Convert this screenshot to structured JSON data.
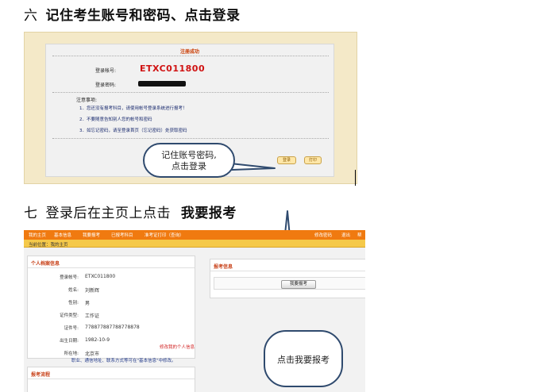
{
  "step6": {
    "number": "六",
    "title": "记住考生账号和密码、点击登录"
  },
  "screenshot1": {
    "success_title": "注册成功",
    "account_label": "登录帐号:",
    "account_value": "ETXC011800",
    "password_label": "登录密码:",
    "notes_title": "注意事项:",
    "notes": [
      "1．您还没有报考科目，请使用帐号登录系统进行报考！",
      "2．不要随意告知别人您的帐号和密码",
      "3．如忘记密码，请至登录首页（忘记密码）处获取密码"
    ],
    "login_button": "登录",
    "print_button": "打印",
    "callout": [
      "记住账号密码,",
      "点击登录"
    ]
  },
  "step7": {
    "number": "七",
    "title_plain": "登录后在主页上点击",
    "title_bold": "我要报考"
  },
  "screenshot2": {
    "nav": [
      "我的主页",
      "基本信息",
      "我要报考",
      "已报考科目",
      "准考证打印（查询）"
    ],
    "nav_right": [
      "修改密码",
      "退出",
      "帮"
    ],
    "location_label": "当前位置：我的主页",
    "profile_title": "个人档案信息",
    "profile_fields": [
      {
        "label": "登录帐号:",
        "value": "ETXC011800"
      },
      {
        "label": "姓名:",
        "value": "刘新辉"
      },
      {
        "label": "性别:",
        "value": "男"
      },
      {
        "label": "证件类型:",
        "value": "工作证"
      },
      {
        "label": "证件号:",
        "value": "778877887788778878"
      },
      {
        "label": "出生日期:",
        "value": "1982-10-9"
      },
      {
        "label": "所在地:",
        "value": "北京市"
      }
    ],
    "edit_link": "修改我的个人信息",
    "edit_note": "职业、通信地址、联系方式等可在\"基本信息\"中修改。",
    "flow_title": "报考流程",
    "exam_title": "报考信息",
    "apply_button": "我要报考",
    "callout": "点击我要报考"
  }
}
